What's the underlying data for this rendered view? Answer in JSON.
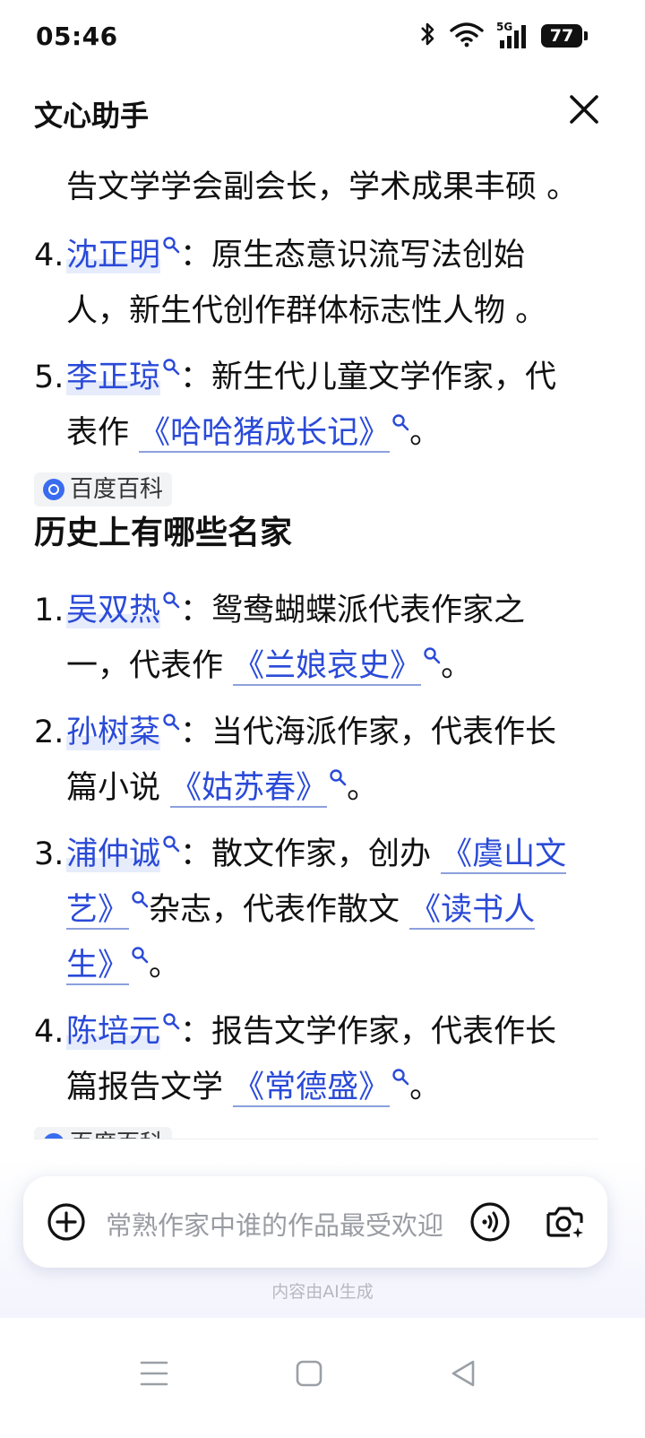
{
  "status_bar": {
    "time": "05:46",
    "network": "5G",
    "battery": "77"
  },
  "header": {
    "title": "文心助手"
  },
  "content": {
    "cont_line": "告文学学会副会长，学术成果丰硕 。",
    "item4": {
      "num": "4.",
      "name": "沈正明",
      "text1": "：原生态意识流写法创始",
      "text2": "人，新生代创作群体标志性人物 。"
    },
    "item5": {
      "num": "5.",
      "name": "李正琼",
      "text1": "：新生代儿童文学作家，代",
      "text2a": "表作 ",
      "work": "《哈哈猪成长记》",
      "text2b": "。",
      "source": "百度百科"
    },
    "section_title": "历史上有哪些名家",
    "h1": {
      "num": "1.",
      "name": "吴双热",
      "text1": "：鸳鸯蝴蝶派代表作家之",
      "text2a": "一，代表作 ",
      "work": "《兰娘哀史》",
      "text2b": "。"
    },
    "h2": {
      "num": "2.",
      "name": "孙树棻",
      "text1": "：当代海派作家，代表作长",
      "text2a": "篇小说 ",
      "work": "《姑苏春》",
      "text2b": "。"
    },
    "h3": {
      "num": "3.",
      "name": "浦仲诚",
      "text1": "：散文作家，创办 ",
      "work1a": "《虞山文",
      "work1b": "艺》",
      "text2": "杂志，代表作散文 ",
      "work2a": "《读书人",
      "work2b": "生》",
      "text3": "。"
    },
    "h4": {
      "num": "4.",
      "name": "陈培元",
      "text1": "：报告文学作家，代表作长",
      "text2a": "篇报告文学 ",
      "work": "《常德盛》",
      "text2b": "。",
      "source": "百度百科"
    }
  },
  "input": {
    "placeholder": "常熟作家中谁的作品最受欢迎"
  },
  "notice": "内容由AI生成",
  "colors": {
    "link": "#2a4ad8",
    "text": "#111111",
    "muted": "#9a9ca3"
  }
}
